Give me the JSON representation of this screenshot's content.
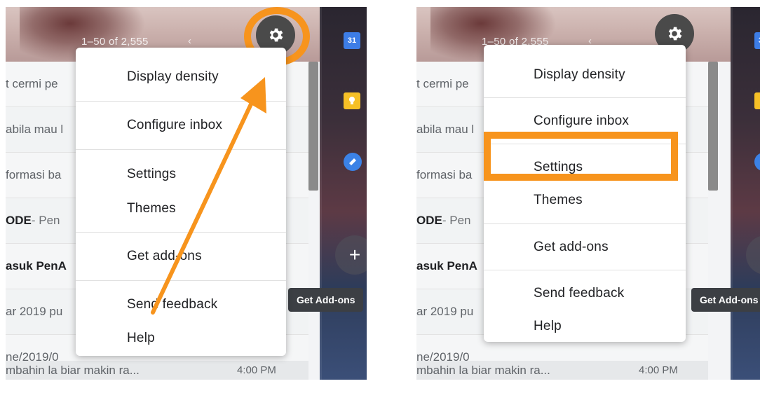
{
  "inbox": {
    "pagination": "1–50 of 2,555",
    "nav_arrows": "‹ ›",
    "rows": [
      {
        "text": "t cermi pe",
        "bold": false
      },
      {
        "text": "abila mau l",
        "bold": false
      },
      {
        "text": "formasi ba",
        "bold": false
      },
      {
        "text": "ODE",
        "suffix": " - Pen",
        "bold": true
      },
      {
        "text": "asuk PenA",
        "bold": true
      },
      {
        "text": "ar 2019 pu",
        "bold": false
      },
      {
        "text": "ne/2019/0",
        "bold": false
      }
    ],
    "last_row": {
      "text": "mbahin la biar makin ra...",
      "time": "4:00 PM"
    }
  },
  "left_panel": {
    "rows": [
      {
        "text": "t cermi pe"
      },
      {
        "text": "abila mau l"
      },
      {
        "text": "formasi ba"
      },
      {
        "text": "ODE",
        "suffix": " - Pen"
      },
      {
        "text": "asuk PenA"
      },
      {
        "text": "ar 2019 pu"
      },
      {
        "text": "ne/2019/0"
      }
    ]
  },
  "right_panel": {
    "rows": [
      {
        "text": "t cermi pe"
      },
      {
        "text": "abila mau l"
      },
      {
        "text": "formasi ba"
      },
      {
        "text": "ODE",
        "suffix": " - Pen"
      },
      {
        "text": "asuk PenA"
      },
      {
        "text": "ar 2019 pu"
      },
      {
        "text": "ne/2019/0"
      }
    ]
  },
  "menu": {
    "display_density": "Display density",
    "configure_inbox": "Configure inbox",
    "settings": "Settings",
    "themes": "Themes",
    "get_addons": "Get add-ons",
    "send_feedback": "Send feedback",
    "help": "Help"
  },
  "sidebar": {
    "calendar_label": "31",
    "plus": "+",
    "tooltip": "Get Add-ons"
  },
  "icons": {
    "gear": "gear-icon",
    "calendar": "calendar-icon",
    "keep": "keep-icon",
    "tasks": "tasks-icon",
    "add": "plus-icon"
  },
  "colors": {
    "highlight": "#f7941d",
    "gear_bg": "#4a4a4a",
    "tooltip_bg": "#3c3f44"
  }
}
